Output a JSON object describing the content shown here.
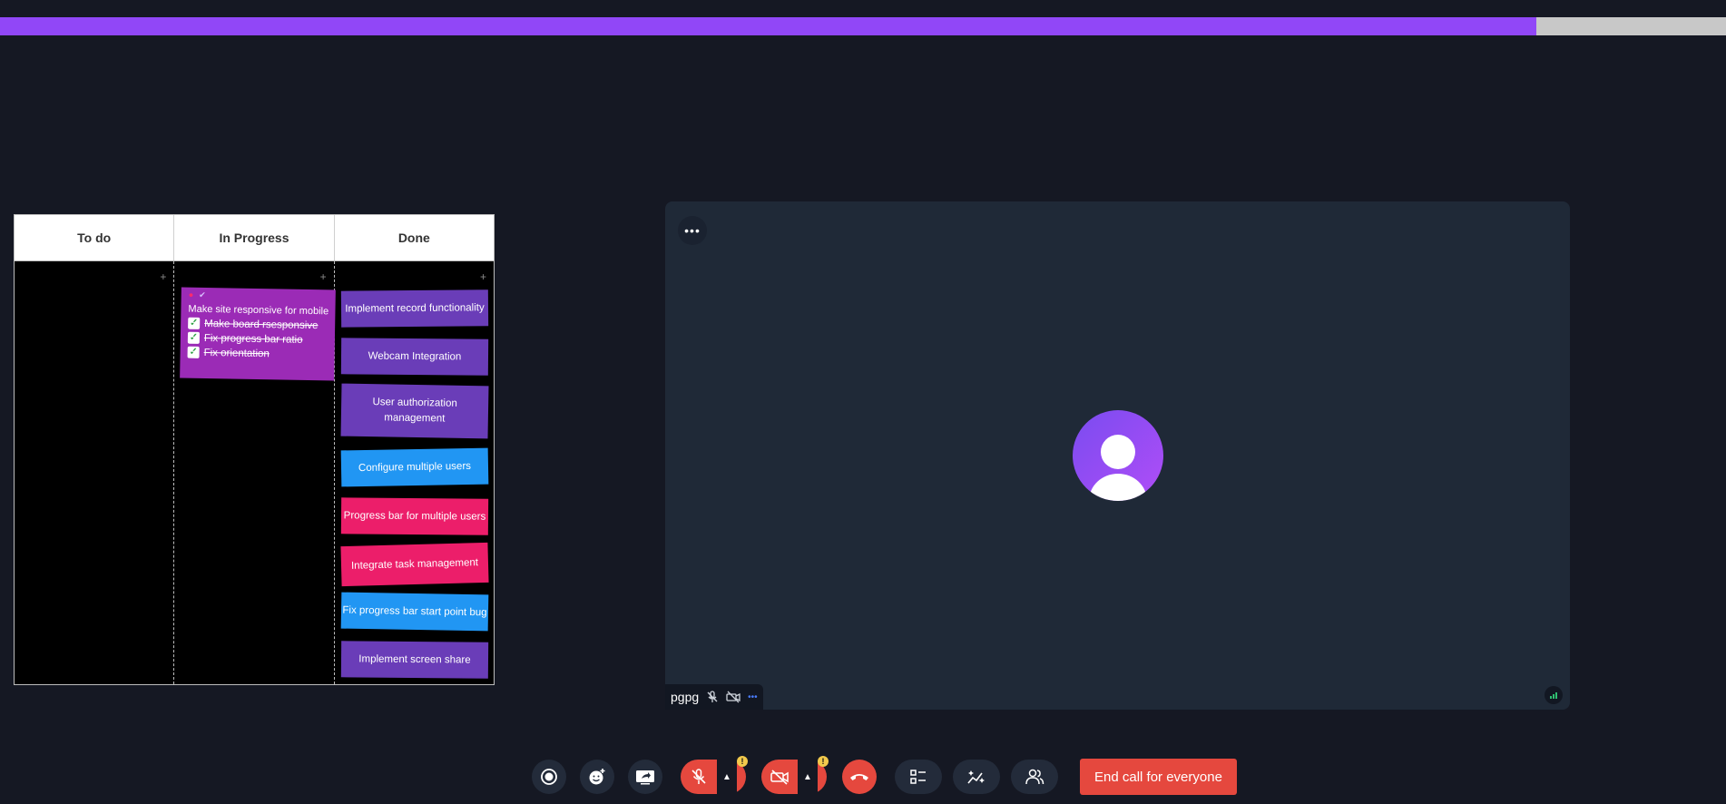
{
  "progress": {
    "fraction": 0.89,
    "fill_color": "#9147f7",
    "track_color": "#c8c8c8"
  },
  "board": {
    "columns": [
      {
        "title": "To do",
        "add_icon": "+"
      },
      {
        "title": "In Progress",
        "add_icon": "+"
      },
      {
        "title": "Done",
        "add_icon": "+"
      }
    ],
    "in_progress_card": {
      "title": "Make site responsive for mobile",
      "subtasks": [
        "Make board rsesponsive",
        "Fix progress bar ratio",
        "Fix orientation"
      ]
    },
    "done_cards": [
      {
        "text": "Implement record functionality",
        "color": "#6a3db8"
      },
      {
        "text": "Webcam Integration",
        "color": "#6a3db8"
      },
      {
        "text": "User authorization management",
        "color": "#6a3db8"
      },
      {
        "text": "Configure multiple users",
        "color": "#2196f3"
      },
      {
        "text": "Progress bar for multiple users",
        "color": "#ec1e6a"
      },
      {
        "text": "Integrate task management",
        "color": "#ec1e6a"
      },
      {
        "text": "Fix progress bar start point bug",
        "color": "#2196f3"
      },
      {
        "text": "Implement screen share",
        "color": "#6a3db8"
      }
    ]
  },
  "tile": {
    "menu_icon": "•••",
    "participant_name": "pgpg",
    "dots": "•••"
  },
  "controls": {
    "end_call_label": "End call for everyone",
    "warn_badge": "!",
    "caret": "▲"
  }
}
